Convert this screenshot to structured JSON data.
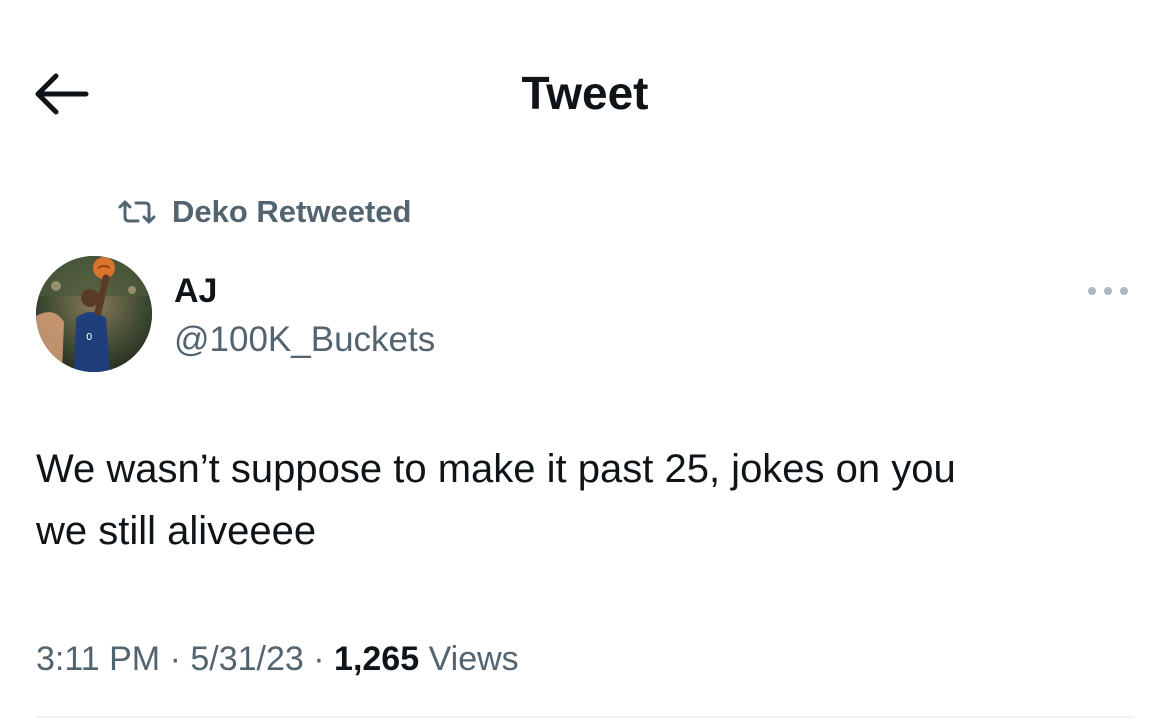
{
  "header": {
    "back_icon": "arrow-left-icon",
    "title": "Tweet"
  },
  "retweet": {
    "icon": "retweet-icon",
    "label": "Deko Retweeted"
  },
  "tweet": {
    "author": {
      "name": "AJ",
      "handle": "@100K_Buckets",
      "avatar": "avatar-photo-basketball-player"
    },
    "more_icon": "more-horizontal-icon",
    "text_line1": "We wasn’t suppose to make it past 25, jokes on you",
    "text_line2": "we still aliveeee",
    "time": "3:11 PM",
    "date": "5/31/23",
    "separator": "·",
    "views_count": "1,265",
    "views_label": "Views"
  },
  "colors": {
    "text_primary": "#0f1419",
    "text_secondary": "#536471",
    "divider": "#eff3f4",
    "background": "#ffffff"
  }
}
